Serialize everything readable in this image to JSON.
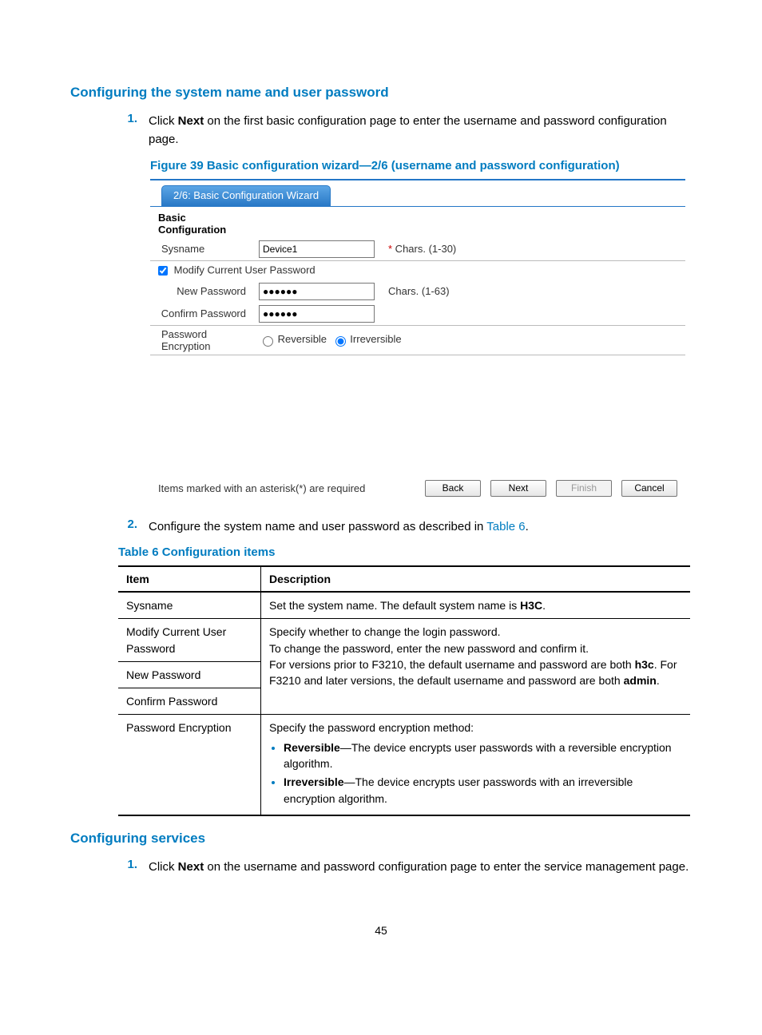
{
  "h3_1": "Configuring the system name and user password",
  "step1_num": "1.",
  "step1_a": "Click ",
  "step1_next": "Next",
  "step1_b": " on the first basic configuration page to enter the username and password configuration page.",
  "figcap": "Figure 39 Basic configuration wizard—2/6 (username and password configuration)",
  "wiz": {
    "tab": "2/6: Basic Configuration Wizard",
    "section": "Basic Configuration",
    "sysname_lbl": "Sysname",
    "sysname_val": "Device1",
    "sysname_hint": " Chars. (1-30)",
    "modify_chk": "Modify Current User Password",
    "newpw_lbl": "New Password",
    "newpw_val": "●●●●●●",
    "newpw_hint": "Chars. (1-63)",
    "confpw_lbl": "Confirm Password",
    "confpw_val": "●●●●●●",
    "enc_lbl": "Password Encryption",
    "enc_rev": "Reversible",
    "enc_irr": "Irreversible",
    "footer_text": "Items marked with an asterisk(*) are required",
    "btn_back": "Back",
    "btn_next": "Next",
    "btn_finish": "Finish",
    "btn_cancel": "Cancel"
  },
  "step2_num": "2.",
  "step2_a": "Configure the system name and user password as described in ",
  "step2_link": "Table 6",
  "step2_b": ".",
  "tabcap": "Table 6 Configuration items",
  "thead_item": "Item",
  "thead_desc": "Description",
  "row1_item": "Sysname",
  "row1_desc_a": "Set the system name. The default system name is ",
  "row1_desc_b": "H3C",
  "row1_desc_c": ".",
  "row2_item": "Modify Current User Password",
  "row_grp_desc_l1": "Specify whether to change the login password.",
  "row_grp_desc_l2": "To change the password, enter the new password and confirm it.",
  "row_grp_desc_l3a": "For versions prior to F3210, the default username and password are both ",
  "row_grp_desc_l3b": "h3c",
  "row_grp_desc_l3c": ". For F3210 and later versions, the default username and password are both ",
  "row_grp_desc_l3d": "admin",
  "row_grp_desc_l3e": ".",
  "row3_item": "New Password",
  "row4_item": "Confirm Password",
  "row5_item": "Password Encryption",
  "row5_desc_intro": "Specify the password encryption method:",
  "row5_li1_b": "Reversible",
  "row5_li1_t": "—The device encrypts user passwords with a reversible encryption algorithm.",
  "row5_li2_b": "Irreversible",
  "row5_li2_t": "—The device encrypts user passwords with an irreversible encryption algorithm.",
  "h3_2": "Configuring services",
  "svc_step1_num": "1.",
  "svc_step1_a": "Click ",
  "svc_step1_next": "Next",
  "svc_step1_b": " on the username and password configuration page to enter the service management page.",
  "page_num": "45"
}
